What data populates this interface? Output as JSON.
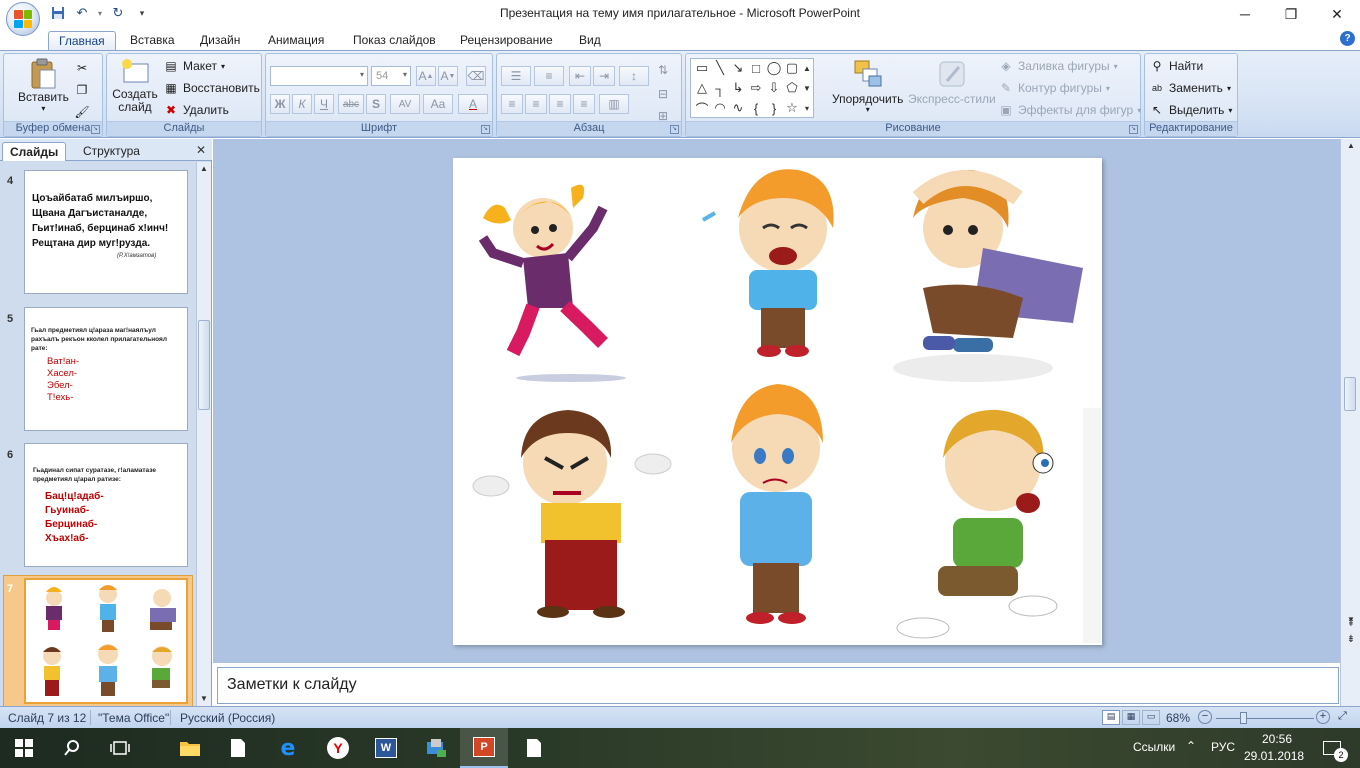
{
  "app": {
    "window_title": "Презентация на тему имя прилагательное - Microsoft PowerPoint"
  },
  "ribbon": {
    "tabs": [
      "Главная",
      "Вставка",
      "Дизайн",
      "Анимация",
      "Показ слайдов",
      "Рецензирование",
      "Вид"
    ],
    "active_tab": "Главная",
    "groups": {
      "clipboard": {
        "label": "Буфер обмена",
        "paste": "Вставить"
      },
      "slides": {
        "label": "Слайды",
        "new_slide": "Создать слайд",
        "layout": "Макет",
        "reset": "Восстановить",
        "delete": "Удалить"
      },
      "font": {
        "label": "Шрифт",
        "font_name": "",
        "font_size": "54",
        "bold": "Ж",
        "italic": "К",
        "underline": "Ч",
        "strike": "abc",
        "shadow": "S",
        "spacing": "AV",
        "case": "Aa",
        "color": "A"
      },
      "paragraph": {
        "label": "Абзац"
      },
      "drawing": {
        "label": "Рисование",
        "arrange": "Упорядочить",
        "quick_styles": "Экспресс-стили",
        "fill": "Заливка фигуры",
        "outline": "Контур фигуры",
        "effects": "Эффекты для фигур"
      },
      "editing": {
        "label": "Редактирование",
        "find": "Найти",
        "replace": "Заменить",
        "select": "Выделить"
      }
    }
  },
  "left_pane": {
    "tabs": [
      "Слайды",
      "Структура"
    ],
    "active_tab": "Слайды",
    "slides": [
      {
        "number": "4",
        "lines": [
          "Цоъайбатаб милъиршо,",
          "Щвана Дагъистаналде,",
          "Гьит!инаб, берцинаб х!инч!",
          "Рещтана дир муг!рузда."
        ],
        "author": "(Р.Х!амзатов)"
      },
      {
        "number": "5",
        "heading": "Гьал предметиял ц!араза маг!наялъул рахъалъ рекъон кколел прилагательноял рате:",
        "items": [
          "Ват!ан-",
          "Хасел-",
          "Эбел-",
          "Т!ехь-"
        ]
      },
      {
        "number": "6",
        "heading": "Гьадинал сипат суратазе, г!аламатазе предметиял ц!арал ратизе:",
        "items": [
          "Бац!ц!адаб-",
          "Гьуинаб-",
          "Берцинаб-",
          "Хъах!аб-"
        ]
      },
      {
        "number": "7",
        "selected": true
      }
    ]
  },
  "notes": {
    "placeholder": "Заметки к слайду"
  },
  "status": {
    "slide_info": "Слайд 7 из 12",
    "theme": "\"Тема Office\"",
    "language": "Русский (Россия)",
    "zoom": "68%"
  },
  "taskbar": {
    "tray_links": "Ссылки",
    "lang": "РУС",
    "time": "20:56",
    "date": "29.01.2018",
    "notif_count": "2"
  },
  "colors": {
    "accent": "#2b579a",
    "red_text": "#c00000",
    "thumb_selected": "#e8a237"
  }
}
